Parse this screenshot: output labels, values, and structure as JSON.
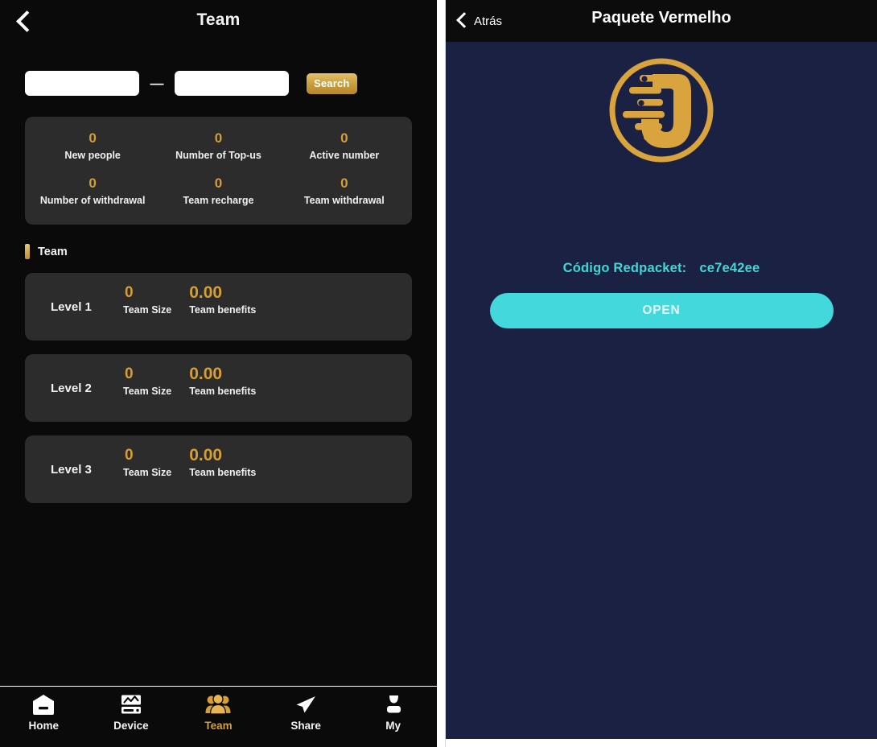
{
  "left_screen": {
    "header": {
      "title": "Team",
      "back_icon": "chevron-left-icon"
    },
    "search": {
      "from_value": "",
      "to_value": "",
      "from_placeholder": "",
      "to_placeholder": "",
      "separator": "—",
      "button_label": "Search"
    },
    "stats": [
      {
        "value": "0",
        "label": "New people"
      },
      {
        "value": "0",
        "label": "Number of Top-us"
      },
      {
        "value": "0",
        "label": "Active number"
      },
      {
        "value": "0",
        "label": "Number of withdrawal"
      },
      {
        "value": "0",
        "label": "Team recharge"
      },
      {
        "value": "0",
        "label": "Team withdrawal"
      }
    ],
    "section": {
      "title": "Team"
    },
    "levels": [
      {
        "name": "Level 1",
        "size_value": "0",
        "size_label": "Team Size",
        "benefit_value": "0.00",
        "benefit_label": "Team benefits"
      },
      {
        "name": "Level 2",
        "size_value": "0",
        "size_label": "Team Size",
        "benefit_value": "0.00",
        "benefit_label": "Team benefits"
      },
      {
        "name": "Level 3",
        "size_value": "0",
        "size_label": "Team Size",
        "benefit_value": "0.00",
        "benefit_label": "Team benefits"
      }
    ],
    "tabbar": [
      {
        "label": "Home",
        "icon": "home-icon",
        "active": false
      },
      {
        "label": "Device",
        "icon": "device-monitor-icon",
        "active": false
      },
      {
        "label": "Team",
        "icon": "people-group-icon",
        "active": true
      },
      {
        "label": "Share",
        "icon": "paper-plane-icon",
        "active": false
      },
      {
        "label": "My",
        "icon": "user-person-icon",
        "active": false
      }
    ]
  },
  "right_screen": {
    "header": {
      "back_label": "Atrás",
      "back_icon": "chevron-left-icon",
      "title": "Paquete Vermelho"
    },
    "logo": {
      "icon": "company-u-logo-icon"
    },
    "redpacket": {
      "code_label": "Código Redpacket:",
      "code_value": "ce7e42ee",
      "open_button_label": "OPEN"
    }
  },
  "colors": {
    "gold": "#d79e34",
    "cyan": "#42d8dc",
    "panel_dark": "#2c2c2c",
    "left_bg": "#0a0a0a",
    "right_bg": "#1a2142"
  }
}
